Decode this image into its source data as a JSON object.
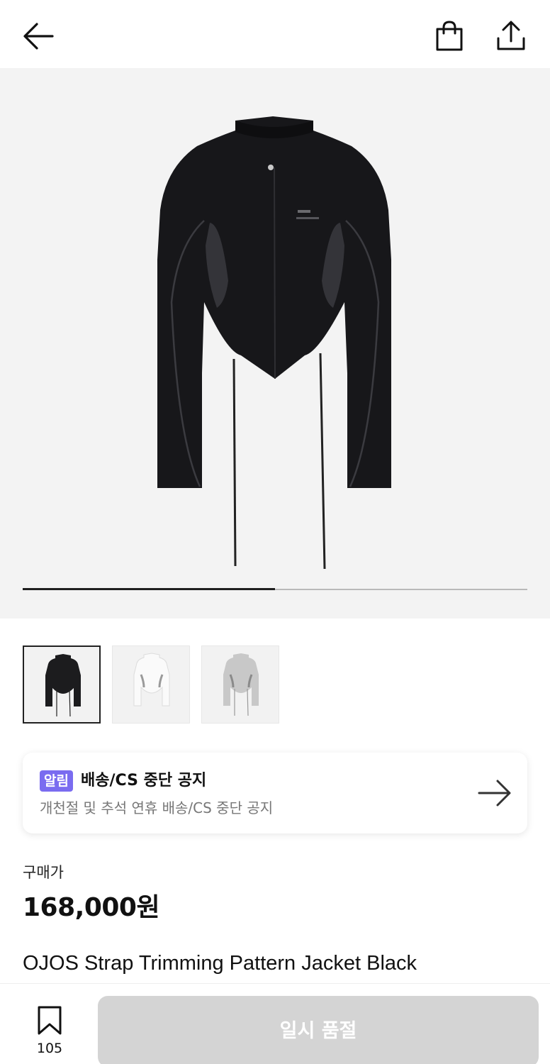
{
  "header": {
    "back_icon": "arrow-left-icon",
    "bag_icon": "shopping-bag-icon",
    "share_icon": "share-upload-icon"
  },
  "gallery": {
    "current_image": 1,
    "total_images": 2,
    "progress_fraction": 0.5
  },
  "thumbnails": [
    {
      "color": "#1c1c1e",
      "selected": true
    },
    {
      "color": "#f0f0f0",
      "selected": false
    },
    {
      "color": "#c8c8c8",
      "selected": false
    }
  ],
  "notice": {
    "tag": "알림",
    "title": "배송/CS 중단 공지",
    "subtitle": "개천절 및 추석 연휴 배송/CS 중단 공지",
    "tag_color": "#7a6cf0"
  },
  "price": {
    "label": "구매가",
    "value": "168,000원"
  },
  "product": {
    "title": "OJOS Strap Trimming Pattern Jacket Black"
  },
  "bottom_bar": {
    "wishlist_icon": "bookmark-icon",
    "wishlist_count": "105",
    "buy_button_label": "일시 품절"
  }
}
